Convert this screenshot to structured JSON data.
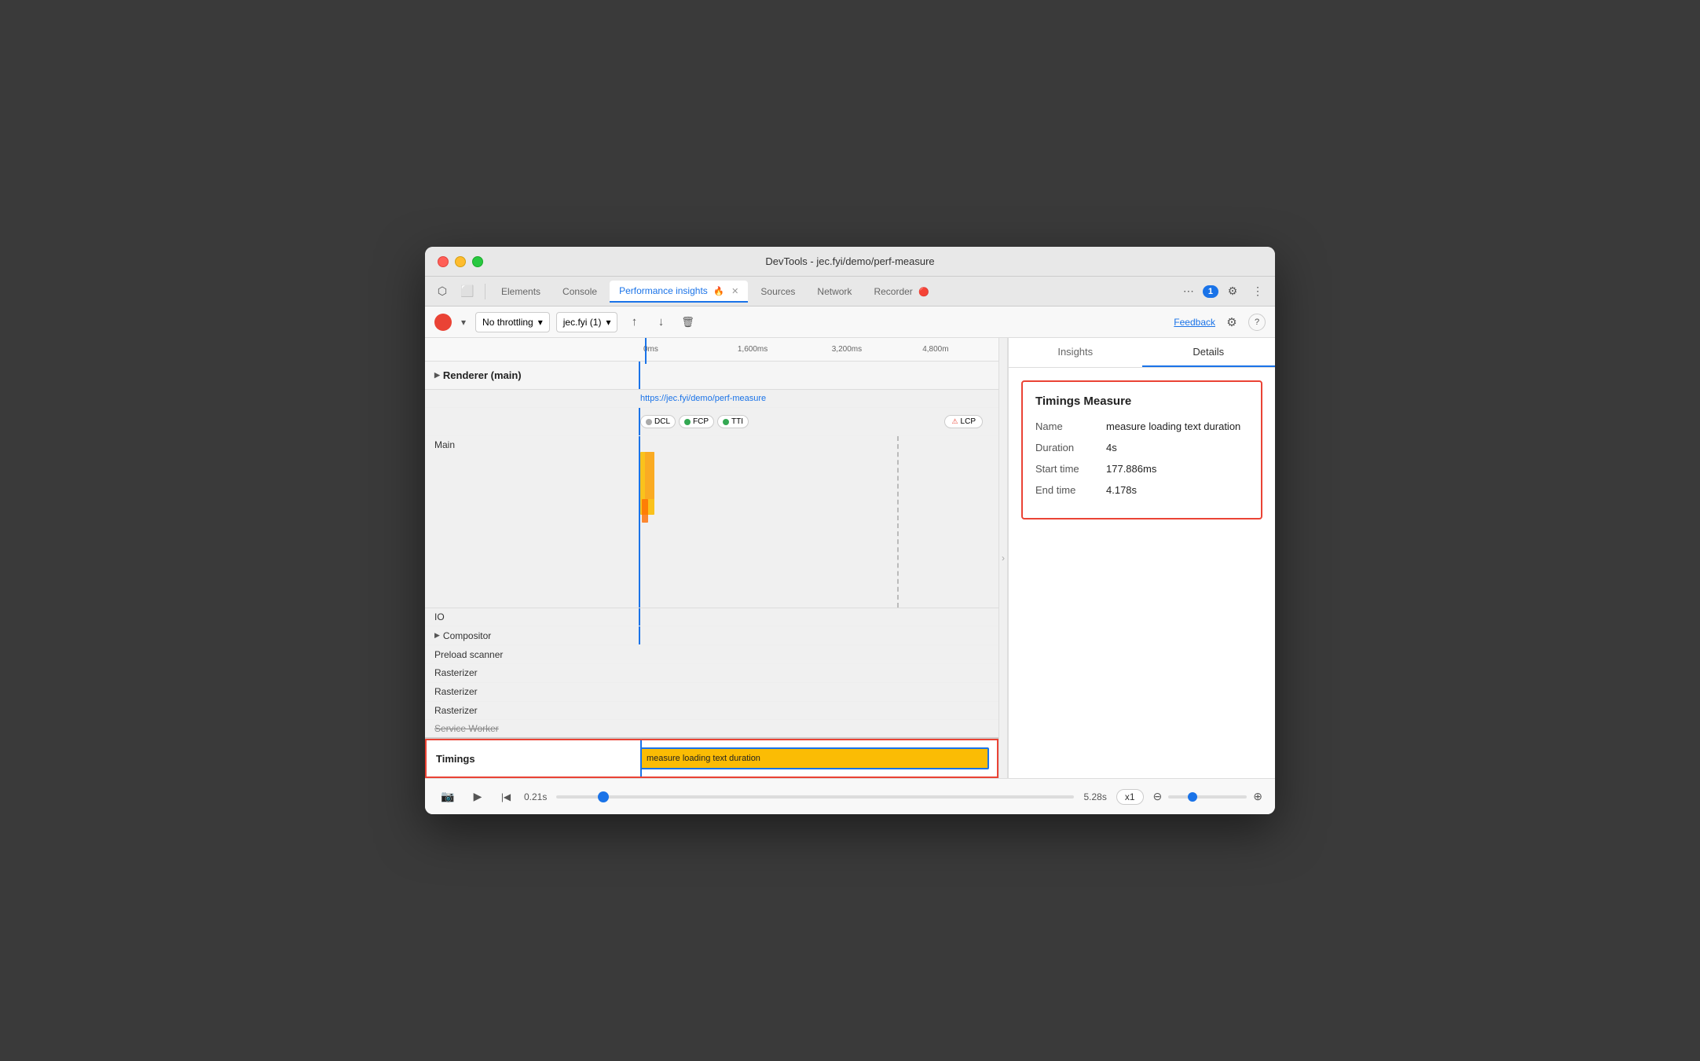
{
  "window": {
    "title": "DevTools - jec.fyi/demo/perf-measure"
  },
  "tabs": [
    {
      "id": "elements",
      "label": "Elements",
      "active": false
    },
    {
      "id": "console",
      "label": "Console",
      "active": false
    },
    {
      "id": "performance",
      "label": "Performance insights",
      "active": true
    },
    {
      "id": "sources",
      "label": "Sources",
      "active": false
    },
    {
      "id": "network",
      "label": "Network",
      "active": false
    },
    {
      "id": "recorder",
      "label": "Recorder",
      "active": false
    }
  ],
  "toolbar": {
    "throttle": "No throttling",
    "instance": "jec.fyi (1)",
    "feedback": "Feedback"
  },
  "timeline": {
    "markers": [
      "0ms",
      "1,600ms",
      "3,200ms",
      "4,800m"
    ],
    "url": "https://jec.fyi/demo/perf-measure",
    "milestones": [
      "DCL",
      "FCP",
      "TTI",
      "LCP"
    ]
  },
  "tracks": [
    {
      "id": "renderer",
      "label": "Renderer (main)"
    },
    {
      "id": "main",
      "label": "Main"
    },
    {
      "id": "io",
      "label": "IO"
    },
    {
      "id": "compositor",
      "label": "Compositor"
    },
    {
      "id": "preload",
      "label": "Preload scanner"
    },
    {
      "id": "rasterizer1",
      "label": "Rasterizer"
    },
    {
      "id": "rasterizer2",
      "label": "Rasterizer"
    },
    {
      "id": "rasterizer3",
      "label": "Rasterizer"
    },
    {
      "id": "service-worker",
      "label": "Service Worker"
    },
    {
      "id": "timings",
      "label": "Timings"
    }
  ],
  "timings_bar": {
    "label": "measure loading text duration"
  },
  "right_panel": {
    "tabs": [
      "Insights",
      "Details"
    ],
    "active_tab": "Details",
    "details": {
      "title": "Timings Measure",
      "rows": [
        {
          "key": "Name",
          "value": "measure loading text duration"
        },
        {
          "key": "Duration",
          "value": "4s"
        },
        {
          "key": "Start time",
          "value": "177.886ms"
        },
        {
          "key": "End time",
          "value": "4.178s"
        }
      ]
    }
  },
  "bottom_bar": {
    "time_start": "0.21s",
    "time_end": "5.28s",
    "speed": "x1"
  },
  "icons": {
    "record": "⏺",
    "dropdown_arrow": "▾",
    "upload": "↑",
    "download": "↓",
    "trash": "🗑",
    "settings": "⚙",
    "help": "?",
    "more": "⋯",
    "play": "▶",
    "skip": "|◀",
    "zoom_in": "⊕",
    "zoom_out": "⊖",
    "screenshot": "📷",
    "collapse": "▶",
    "chat": "1"
  }
}
